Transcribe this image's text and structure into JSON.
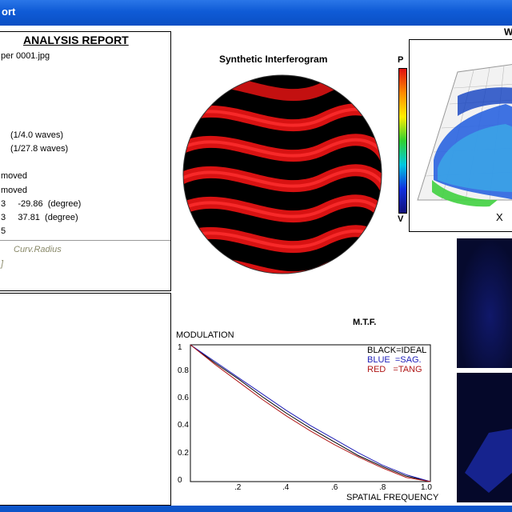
{
  "window": {
    "title": "ort"
  },
  "report": {
    "heading": "ANALYSIS  REPORT",
    "lines": [
      "per 0001.jpg",
      "(1/4.0 waves)",
      "(1/27.8 waves)",
      "moved",
      "moved",
      "3     -29.86  (degree)",
      "3     37.81  (degree)",
      "5"
    ],
    "curv_label": "Curv.Radius",
    "curv_bracket": "]"
  },
  "interferogram": {
    "title": "Synthetic Interferogram"
  },
  "surface_plot": {
    "title": "W",
    "scale_top": "P",
    "scale_bottom": "V",
    "x_axis": "X"
  },
  "mtf": {
    "title": "M.T.F.",
    "y_title": "MODULATION",
    "x_title": "SPATIAL FREQUENCY",
    "y_ticks": [
      "1",
      "0.8",
      "0.6",
      "0.4",
      "0.2",
      "0"
    ],
    "x_ticks": [
      ".2",
      ".4",
      ".6",
      ".8",
      "1.0"
    ],
    "legend": [
      "BLACK=IDEAL",
      "BLUE  =SAG.",
      "RED   =TANG"
    ],
    "colors": {
      "ideal": "#000000",
      "sag": "#1f1fb8",
      "tang": "#b01818"
    }
  },
  "chart_data": {
    "type": "line",
    "title": "M.T.F.",
    "xlabel": "SPATIAL FREQUENCY",
    "ylabel": "MODULATION",
    "xlim": [
      0,
      1.0
    ],
    "ylim": [
      0,
      1
    ],
    "x": [
      0,
      0.1,
      0.2,
      0.3,
      0.4,
      0.5,
      0.6,
      0.7,
      0.8,
      0.9,
      1.0
    ],
    "series": [
      {
        "name": "IDEAL",
        "values": [
          1.0,
          0.87,
          0.75,
          0.62,
          0.5,
          0.39,
          0.29,
          0.19,
          0.11,
          0.04,
          0.0
        ]
      },
      {
        "name": "SAG",
        "values": [
          1.0,
          0.88,
          0.76,
          0.64,
          0.52,
          0.41,
          0.31,
          0.21,
          0.12,
          0.05,
          0.0
        ]
      },
      {
        "name": "TANG",
        "values": [
          1.0,
          0.86,
          0.73,
          0.6,
          0.48,
          0.37,
          0.27,
          0.18,
          0.1,
          0.03,
          0.0
        ]
      }
    ]
  }
}
